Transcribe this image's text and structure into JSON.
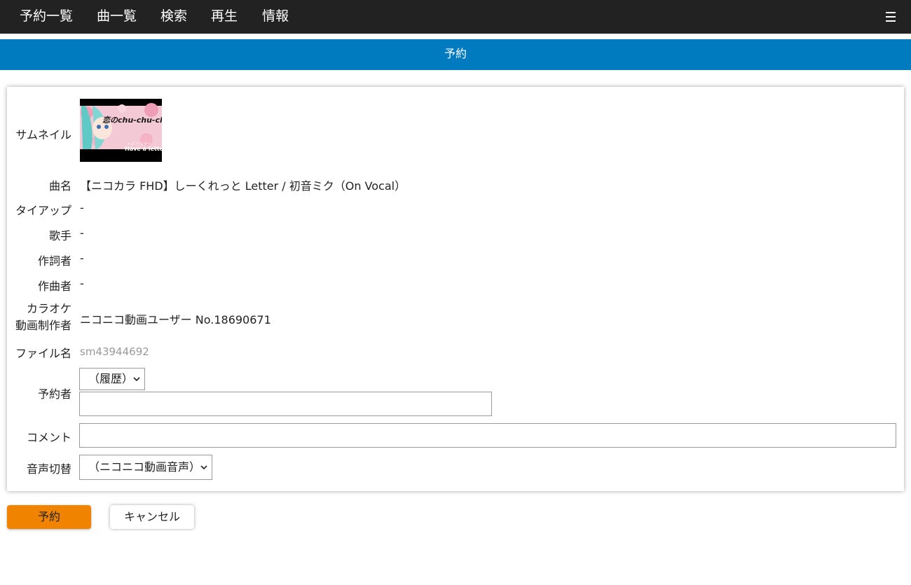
{
  "nav": {
    "items": [
      "予約一覧",
      "曲一覧",
      "検索",
      "再生",
      "情報"
    ],
    "menu_icon": "hamburger-icon"
  },
  "title": "予約",
  "form": {
    "thumbnail_label": "サムネイル",
    "thumbnail_text": {
      "main": "恋のchu-chu-ch",
      "sub": "Have a letter",
      "ruby": "ハブ ア レター"
    },
    "song_label": "曲名",
    "song_value": "【ニコカラ FHD】しーくれっと Letter / 初音ミク（On Vocal）",
    "tieup_label": "タイアップ",
    "tieup_value": "-",
    "singer_label": "歌手",
    "singer_value": "-",
    "lyricist_label": "作詞者",
    "lyricist_value": "-",
    "composer_label": "作曲者",
    "composer_value": "-",
    "karaoke_maker_label_line1": "カラオケ",
    "karaoke_maker_label_line2": "動画制作者",
    "karaoke_maker_value": "ニコニコ動画ユーザー No.18690671",
    "filename_label": "ファイル名",
    "filename_value": "sm43944692",
    "requester_label": "予約者",
    "history_select": "（履歴）",
    "requester_input_value": "",
    "comment_label": "コメント",
    "comment_input_value": "",
    "audio_label": "音声切替",
    "audio_select": "（ニコニコ動画音声）"
  },
  "buttons": {
    "reserve": "予約",
    "cancel": "キャンセル"
  },
  "colors": {
    "navbar": "#222222",
    "titlebar": "#007bbf",
    "primary_button": "#f08300"
  }
}
